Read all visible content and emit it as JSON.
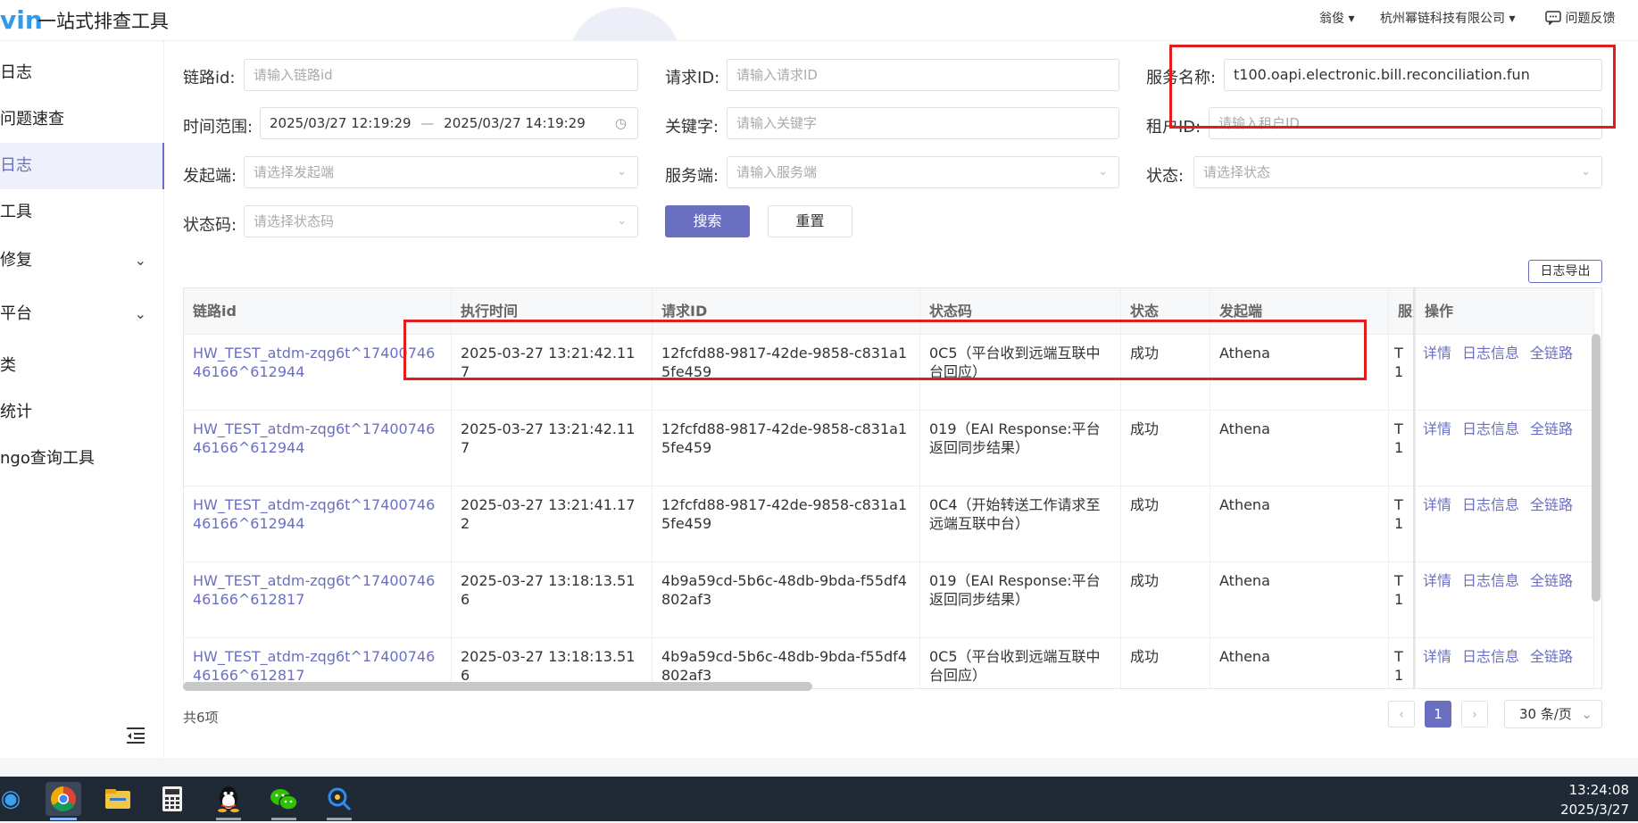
{
  "app": {
    "logo": "vin",
    "title": "一站式排查工具"
  },
  "header": {
    "user": "翁俊",
    "company": "杭州幂链科技有限公司",
    "feedback": "问题反馈"
  },
  "sidebar": {
    "items": [
      {
        "label": "日志",
        "top": 0
      },
      {
        "label": "问题速查"
      },
      {
        "label": "日志"
      },
      {
        "label": "工具"
      },
      {
        "label": "修复"
      },
      {
        "label": "平台"
      },
      {
        "label": "类"
      },
      {
        "label": "统计"
      },
      {
        "label": "ngo查询工具"
      }
    ]
  },
  "filters": {
    "trace_id": {
      "label": "链路id:",
      "placeholder": "请输入链路id"
    },
    "request_id": {
      "label": "请求ID:",
      "placeholder": "请输入请求ID"
    },
    "service_name": {
      "label": "服务名称:",
      "value": "t100.oapi.electronic.bill.reconciliation.fun"
    },
    "time_range": {
      "label": "时间范围:",
      "start": "2025/03/27 12:19:29",
      "sep": "—",
      "end": "2025/03/27 14:19:29"
    },
    "keyword": {
      "label": "关键字:",
      "placeholder": "请输入关键字"
    },
    "tenant_id": {
      "label": "租户ID:",
      "placeholder": "请输入租户ID"
    },
    "initiator": {
      "label": "发起端:",
      "placeholder": "请选择发起端"
    },
    "server": {
      "label": "服务端:",
      "placeholder": "请输入服务端"
    },
    "status": {
      "label": "状态:",
      "placeholder": "请选择状态"
    },
    "status_code": {
      "label": "状态码:",
      "placeholder": "请选择状态码"
    },
    "search_label": "搜索",
    "reset_label": "重置"
  },
  "export_label": "日志导出",
  "table": {
    "headers": [
      "链路id",
      "执行时间",
      "请求ID",
      "状态码",
      "状态",
      "发起端",
      "服务",
      "操作"
    ],
    "actions": [
      "详情",
      "日志信息",
      "全链路"
    ],
    "rows": [
      {
        "trace": "HW_TEST_atdm-zqg6t^1740074646166^612944",
        "time": "2025-03-27 13:21:42.117",
        "req": "12fcfd88-9817-42de-9858-c831a15fe459",
        "code": "0C5（平台收到远端互联中台回应）",
        "status": "成功",
        "init": "Athena",
        "svc": "T1"
      },
      {
        "trace": "HW_TEST_atdm-zqg6t^1740074646166^612944",
        "time": "2025-03-27 13:21:42.117",
        "req": "12fcfd88-9817-42de-9858-c831a15fe459",
        "code": "019（EAI Response:平台返回同步结果）",
        "status": "成功",
        "init": "Athena",
        "svc": "T1"
      },
      {
        "trace": "HW_TEST_atdm-zqg6t^1740074646166^612944",
        "time": "2025-03-27 13:21:41.172",
        "req": "12fcfd88-9817-42de-9858-c831a15fe459",
        "code": "0C4（开始转送工作请求至远端互联中台）",
        "status": "成功",
        "init": "Athena",
        "svc": "T1"
      },
      {
        "trace": "HW_TEST_atdm-zqg6t^1740074646166^612817",
        "time": "2025-03-27 13:18:13.516",
        "req": "4b9a59cd-5b6c-48db-9bda-f55df4802af3",
        "code": "019（EAI Response:平台返回同步结果）",
        "status": "成功",
        "init": "Athena",
        "svc": "T1"
      },
      {
        "trace": "HW_TEST_atdm-zqg6t^1740074646166^612817",
        "time": "2025-03-27 13:18:13.516",
        "req": "4b9a59cd-5b6c-48db-9bda-f55df4802af3",
        "code": "0C5（平台收到远端互联中台回应）",
        "status": "成功",
        "init": "Athena",
        "svc": "T1"
      }
    ]
  },
  "pagination": {
    "total": "共6项",
    "current": "1",
    "page_size": "30 条/页"
  },
  "taskbar": {
    "time": "13:24:08",
    "date": "2025/3/27"
  },
  "colors": {
    "accent": "#6b6fc2",
    "highlight": "#e21d1d"
  }
}
